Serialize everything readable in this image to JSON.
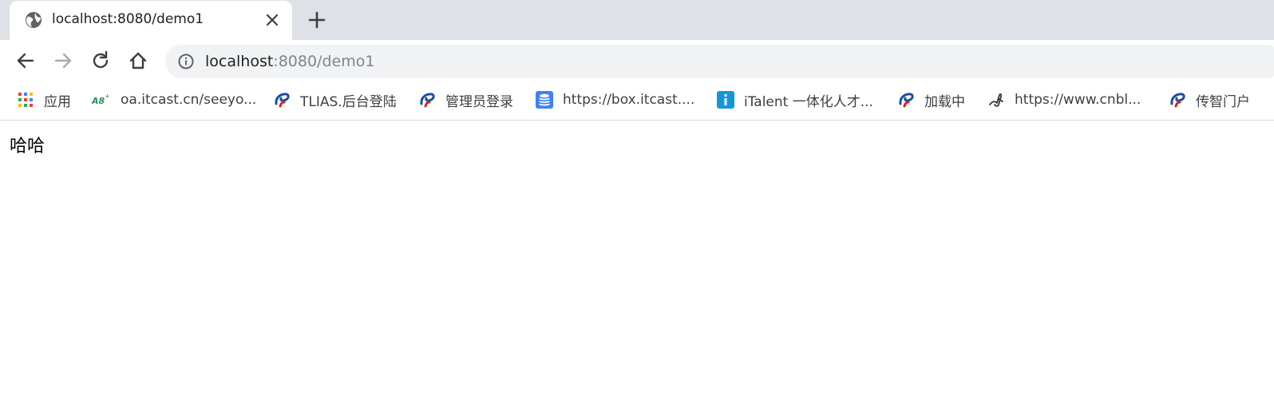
{
  "browser": {
    "tab": {
      "title": "localhost:8080/demo1",
      "icon": "globe-icon",
      "close_icon": "close-icon"
    },
    "new_tab_icon": "plus-icon",
    "nav": {
      "back_icon": "back-arrow-icon",
      "forward_icon": "forward-arrow-icon",
      "reload_icon": "reload-icon",
      "home_icon": "home-icon"
    },
    "omnibox": {
      "info_icon": "info-icon",
      "url_host": "localhost",
      "url_rest": ":8080/demo1"
    }
  },
  "bookmarks": [
    {
      "label": "应用",
      "icon": "apps-grid-icon"
    },
    {
      "label": "oa.itcast.cn/seeyo...",
      "icon": "a8-logo-icon"
    },
    {
      "label": "TLIAS.后台登陆",
      "icon": "swirl-logo-icon"
    },
    {
      "label": "管理员登录",
      "icon": "swirl-logo-icon"
    },
    {
      "label": "https://box.itcast....",
      "icon": "database-icon"
    },
    {
      "label": "iTalent 一体化人才...",
      "icon": "info-badge-icon"
    },
    {
      "label": "加载中",
      "icon": "swirl-logo-icon"
    },
    {
      "label": "https://www.cnbl...",
      "icon": "cnblogs-logo-icon"
    },
    {
      "label": "传智门户",
      "icon": "swirl-logo-icon"
    }
  ],
  "page": {
    "text": "哈哈"
  },
  "colors": {
    "tabstrip": "#dee1e6",
    "omnibox": "#f1f3f4",
    "swirl_blue": "#1a4fa0",
    "swirl_red": "#d6232a",
    "database_blue": "#3b82f6",
    "italent_blue": "#1296db"
  }
}
